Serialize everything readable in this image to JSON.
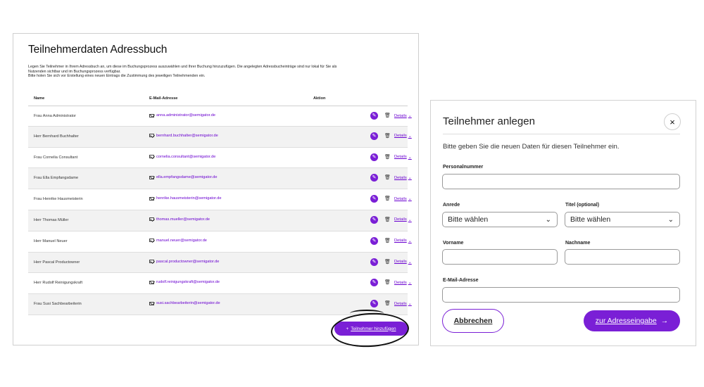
{
  "addressbook": {
    "title": "Teilnehmerdaten Adressbuch",
    "intro_line1": "Legen Sie Teilnehmer in Ihrem Adressbuch an, um diese im Buchungsprozess auszuwählen und Ihrer Buchung hinzuzufügen. Die angelegten Adressbucheinträge sind nur lokal für Sie als",
    "intro_line2": "Nutzenden sichtbar und im Buchungsprozess verfügbar.",
    "intro_line3": "Bitte holen Sie sich vor Erstellung eines neuen Eintrags die Zustimmung des jeweiligen Teilnehmenden ein.",
    "col_name": "Name",
    "col_email": "E-Mail-Adresse",
    "col_action": "Aktion",
    "details_label": "Details",
    "rows": [
      {
        "name": "Frau Anna Administrator",
        "email": "anna.administrator@semigator.de"
      },
      {
        "name": "Herr Bernhard Buchhalter",
        "email": "bernhard.buchhalter@semigator.de"
      },
      {
        "name": "Frau Cornelia Consultant",
        "email": "cornelia.consultant@semigator.de"
      },
      {
        "name": "Frau Ella Empfangsdame",
        "email": "ella.empfangsdame@semigator.de"
      },
      {
        "name": "Frau Henrike Hausmeisterin",
        "email": "henrike.hausmeisterin@semigator.de"
      },
      {
        "name": "Herr Thomas Müller",
        "email": "thomas.mueller@semigator.de"
      },
      {
        "name": "Herr Manuel Neuer",
        "email": "manuel.neuer@semigator.de"
      },
      {
        "name": "Herr Pascal Productowner",
        "email": "pascal.productowner@semigator.de"
      },
      {
        "name": "Herr Rudolf Reinigungskraft",
        "email": "rudolf.reinigungskraft@semigator.de"
      },
      {
        "name": "Frau Susi Sachbearbeiterin",
        "email": "susi.sachbearbeiterin@semigator.de"
      }
    ],
    "add_button_icon": "+",
    "add_button_label": "Teilnehmer hinzufügen"
  },
  "modal": {
    "title": "Teilnehmer anlegen",
    "close_icon": "×",
    "subtitle": "Bitte geben Sie die neuen Daten für diesen Teilnehmer ein.",
    "personalnummer_label": "Personalnummer",
    "anrede_label": "Anrede",
    "anrede_value": "Bitte wählen",
    "titel_label": "Titel (optional)",
    "titel_value": "Bitte wählen",
    "vorname_label": "Vorname",
    "nachname_label": "Nachname",
    "email_label": "E-Mail-Adresse",
    "cancel_label": "Abbrechen",
    "next_label": "zur Adresseingabe",
    "next_arrow": "→"
  },
  "colors": {
    "accent": "#7a1fd6",
    "row_shade": "#f2f2f2"
  },
  "icons": [
    "mail-icon",
    "edit-icon",
    "trash-icon",
    "chevron-down-icon",
    "plus-icon",
    "close-icon",
    "arrow-right-icon"
  ]
}
